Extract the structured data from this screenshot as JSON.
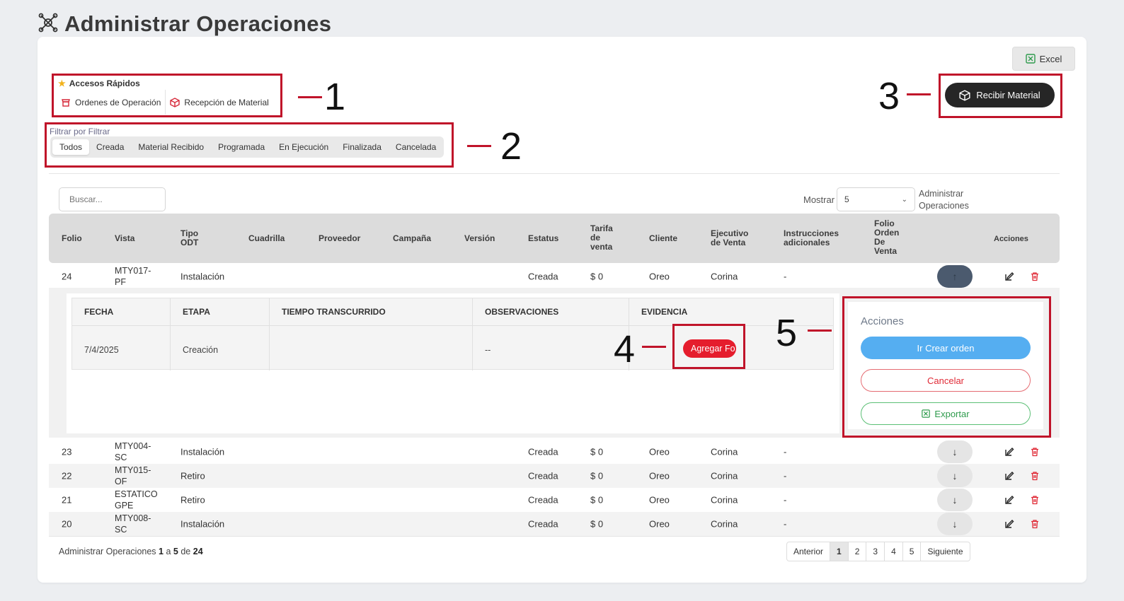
{
  "header": {
    "title": "Administrar Operaciones"
  },
  "toolbar": {
    "excel_label": "Excel"
  },
  "quick_access": {
    "title": "Accesos Rápidos",
    "links": [
      {
        "label": "Ordenes de Operación",
        "icon": "store-icon"
      },
      {
        "label": "Recepción de Material",
        "icon": "package-icon"
      }
    ]
  },
  "filters": {
    "label": "Filtrar por Filtrar",
    "options": [
      "Todos",
      "Creada",
      "Material Recibido",
      "Programada",
      "En Ejecución",
      "Finalizada",
      "Cancelada"
    ],
    "active": "Todos"
  },
  "recibir_button": {
    "label": "Recibir Material"
  },
  "callouts": [
    "1",
    "2",
    "3",
    "4",
    "5"
  ],
  "search": {
    "placeholder": "Buscar..."
  },
  "show": {
    "label": "Mostrar",
    "value": "5",
    "after_line1": "Administrar",
    "after_line2": "Operaciones"
  },
  "table": {
    "columns": {
      "folio": "Folio",
      "vista": "Vista",
      "tipo_l1": "Tipo",
      "tipo_l2": "ODT",
      "cuadrilla": "Cuadrilla",
      "proveedor": "Proveedor",
      "campana": "Campaña",
      "version": "Versión",
      "estatus": "Estatus",
      "tarifa_l1": "Tarifa",
      "tarifa_l2": "de",
      "tarifa_l3": "venta",
      "cliente": "Cliente",
      "ejecutivo_l1": "Ejecutivo",
      "ejecutivo_l2": "de Venta",
      "instr_l1": "Instrucciones",
      "instr_l2": "adicionales",
      "folio_ov_l1": "Folio",
      "folio_ov_l2": "Orden",
      "folio_ov_l3": "De",
      "folio_ov_l4": "Venta",
      "acciones": "Acciones"
    },
    "rows": [
      {
        "folio": "24",
        "vista_l1": "MTY017-",
        "vista_l2": "PF",
        "tipo": "Instalación",
        "estatus": "Creada",
        "tarifa": "$ 0",
        "cliente": "Oreo",
        "ejecutivo": "Corina",
        "instrucciones": "-"
      },
      {
        "folio": "23",
        "vista_l1": "MTY004-",
        "vista_l2": "SC",
        "tipo": "Instalación",
        "estatus": "Creada",
        "tarifa": "$ 0",
        "cliente": "Oreo",
        "ejecutivo": "Corina",
        "instrucciones": "-"
      },
      {
        "folio": "22",
        "vista_l1": "MTY015-",
        "vista_l2": "OF",
        "tipo": "Retiro",
        "estatus": "Creada",
        "tarifa": "$ 0",
        "cliente": "Oreo",
        "ejecutivo": "Corina",
        "instrucciones": "-"
      },
      {
        "folio": "21",
        "vista_l1": "ESTATICO",
        "vista_l2": "GPE",
        "tipo": "Retiro",
        "estatus": "Creada",
        "tarifa": "$ 0",
        "cliente": "Oreo",
        "ejecutivo": "Corina",
        "instrucciones": "-"
      },
      {
        "folio": "20",
        "vista_l1": "MTY008-",
        "vista_l2": "SC",
        "tipo": "Instalación",
        "estatus": "Creada",
        "tarifa": "$ 0",
        "cliente": "Oreo",
        "ejecutivo": "Corina",
        "instrucciones": "-"
      }
    ]
  },
  "detail": {
    "columns": [
      "FECHA",
      "ETAPA",
      "TIEMPO TRANSCURRIDO",
      "OBSERVACIONES",
      "EVIDENCIA"
    ],
    "row": {
      "fecha": "7/4/2025",
      "etapa": "Creación",
      "tiempo": "",
      "observaciones": "--"
    },
    "agregar_label": "Agregar Fo"
  },
  "acciones_panel": {
    "title": "Acciones",
    "crear_label": "Ir Crear orden",
    "cancelar_label": "Cancelar",
    "exportar_label": "Exportar"
  },
  "footer": {
    "prefix": "Administrar Operaciones",
    "from": "1",
    "a": "a",
    "to": "5",
    "de": "de",
    "total": "24"
  },
  "pagination": {
    "prev": "Anterior",
    "pages": [
      "1",
      "2",
      "3",
      "4",
      "5"
    ],
    "next": "Siguiente",
    "current": "1"
  },
  "colors": {
    "accent_red": "#c0142a",
    "dark_button": "#262626",
    "blue_button": "#55aef1",
    "green_button": "#2f9b4d",
    "danger": "#e51d2d"
  }
}
